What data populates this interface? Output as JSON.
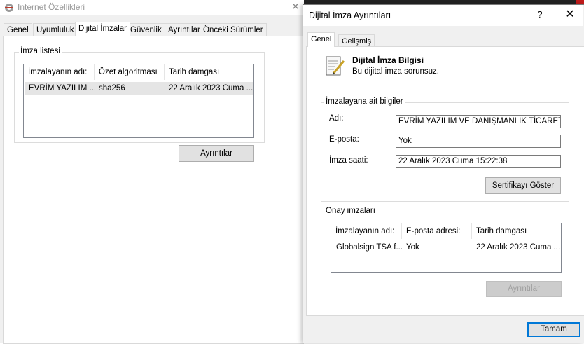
{
  "back_window": {
    "title": "Internet Özellikleri",
    "tabs": [
      "Genel",
      "Uyumluluk",
      "Dijital İmzalar",
      "Güvenlik",
      "Ayrıntılar",
      "Önceki Sürümler"
    ],
    "active_tab": "Dijital İmzalar",
    "signature_group_label": "İmza listesi",
    "list": {
      "headers": [
        "İmzalayanın adı:",
        "Özet algoritması",
        "Tarih damgası"
      ],
      "rows": [
        [
          "EVRİM YAZILIM ...",
          "sha256",
          "22 Aralık 2023 Cuma ..."
        ]
      ]
    },
    "details_button": "Ayrıntılar"
  },
  "dialog": {
    "title": "Dijital İmza Ayrıntıları",
    "help_label": "?",
    "close_label": "✕",
    "tabs": [
      "Genel",
      "Gelişmiş"
    ],
    "active_tab": "Genel",
    "info_heading": "Dijital İmza Bilgisi",
    "info_status": "Bu dijital imza sorunsuz.",
    "signer_group_label": "İmzalayana ait bilgiler",
    "name_label": "Adı:",
    "name_value": "EVRİM YAZILIM VE DANIŞMANLIK TİCARET A.Ş.",
    "email_label": "E-posta:",
    "email_value": "Yok",
    "time_label": "İmza saati:",
    "time_value": "22 Aralık 2023 Cuma 15:22:38",
    "cert_button": "Sertifikayı Göster",
    "countersig_group_label": "Onay imzaları",
    "countersig_list": {
      "headers": [
        "İmzalayanın adı:",
        "E-posta adresi:",
        "Tarih damgası"
      ],
      "rows": [
        [
          "Globalsign TSA f...",
          "Yok",
          "22 Aralık 2023 Cuma ..."
        ]
      ]
    },
    "countersig_details_button": "Ayrıntılar",
    "ok_button": "Tamam"
  },
  "colors": {
    "accent": "#0078d7",
    "window_bg": "#f0f0f0",
    "selection_bg": "#e5e5e5"
  }
}
